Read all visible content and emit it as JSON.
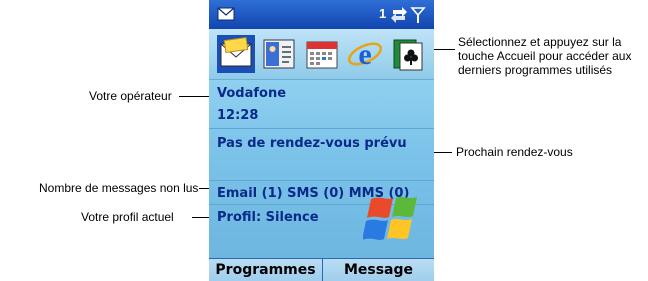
{
  "callouts": {
    "top_right": [
      "Sélectionnez et appuyez sur la",
      "touche Accueil pour accéder aux",
      "derniers programmes utilisés"
    ],
    "operator": "Votre opérateur",
    "next_appointment": "Prochain rendez-vous",
    "unread_messages": "Nombre de messages non lus",
    "profile": "Votre profil actuel"
  },
  "phone": {
    "status_bar": {
      "notification_count": "1"
    },
    "app_icons": [
      "envelope-icon",
      "contacts-card-icon",
      "calendar-icon",
      "internet-explorer-icon",
      "solitaire-icon"
    ],
    "operator": "Vodafone",
    "time": "12:28",
    "appointment": "Pas de rendez-vous prévu",
    "messages": "Email (1) SMS (0) MMS (0)",
    "profile": "Profil: Silence",
    "softkeys": {
      "left": "Programmes",
      "right": "Message"
    }
  },
  "colors": {
    "status_bar": "#1f5bc8",
    "screen_background": "#7fc4e8",
    "text_blue": "#0a2a8a"
  }
}
